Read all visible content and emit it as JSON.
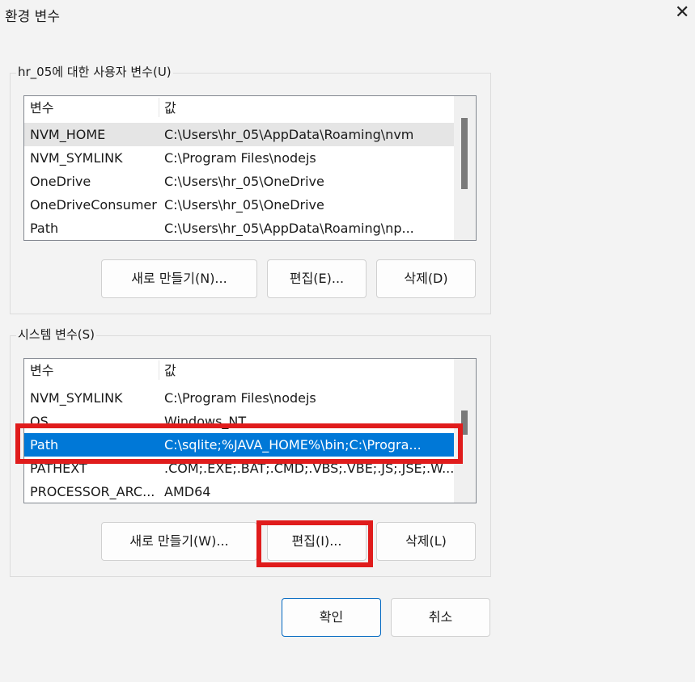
{
  "window": {
    "title": "환경 변수",
    "close_icon": "close-icon"
  },
  "user_vars": {
    "label": "hr_05에 대한 사용자 변수(U)",
    "columns": [
      "변수",
      "값"
    ],
    "rows": [
      {
        "name": "NVM_HOME",
        "value": "C:\\Users\\hr_05\\AppData\\Roaming\\nvm"
      },
      {
        "name": "NVM_SYMLINK",
        "value": "C:\\Program Files\\nodejs"
      },
      {
        "name": "OneDrive",
        "value": "C:\\Users\\hr_05\\OneDrive"
      },
      {
        "name": "OneDriveConsumer",
        "value": "C:\\Users\\hr_05\\OneDrive"
      },
      {
        "name": "Path",
        "value": "C:\\Users\\hr_05\\AppData\\Roaming\\np..."
      }
    ],
    "buttons": {
      "new": "새로 만들기(N)...",
      "edit": "편집(E)...",
      "delete": "삭제(D)"
    }
  },
  "system_vars": {
    "label": "시스템 변수(S)",
    "columns": [
      "변수",
      "값"
    ],
    "rows": [
      {
        "name": "NVM_SYMLINK",
        "value": "C:\\Program Files\\nodejs"
      },
      {
        "name": "OS",
        "value": "Windows_NT"
      },
      {
        "name": "Path",
        "value": "C:\\sqlite;%JAVA_HOME%\\bin;C:\\Progra..."
      },
      {
        "name": "PATHEXT",
        "value": ".COM;.EXE;.BAT;.CMD;.VBS;.VBE;.JS;.JSE;.W..."
      },
      {
        "name": "PROCESSOR_ARC...",
        "value": "AMD64"
      }
    ],
    "buttons": {
      "new": "새로 만들기(W)...",
      "edit": "편집(I)...",
      "delete": "삭제(L)"
    }
  },
  "dialog_buttons": {
    "ok": "확인",
    "cancel": "취소"
  },
  "colors": {
    "selection": "#0078d7",
    "highlight_box": "#e01c1c"
  }
}
